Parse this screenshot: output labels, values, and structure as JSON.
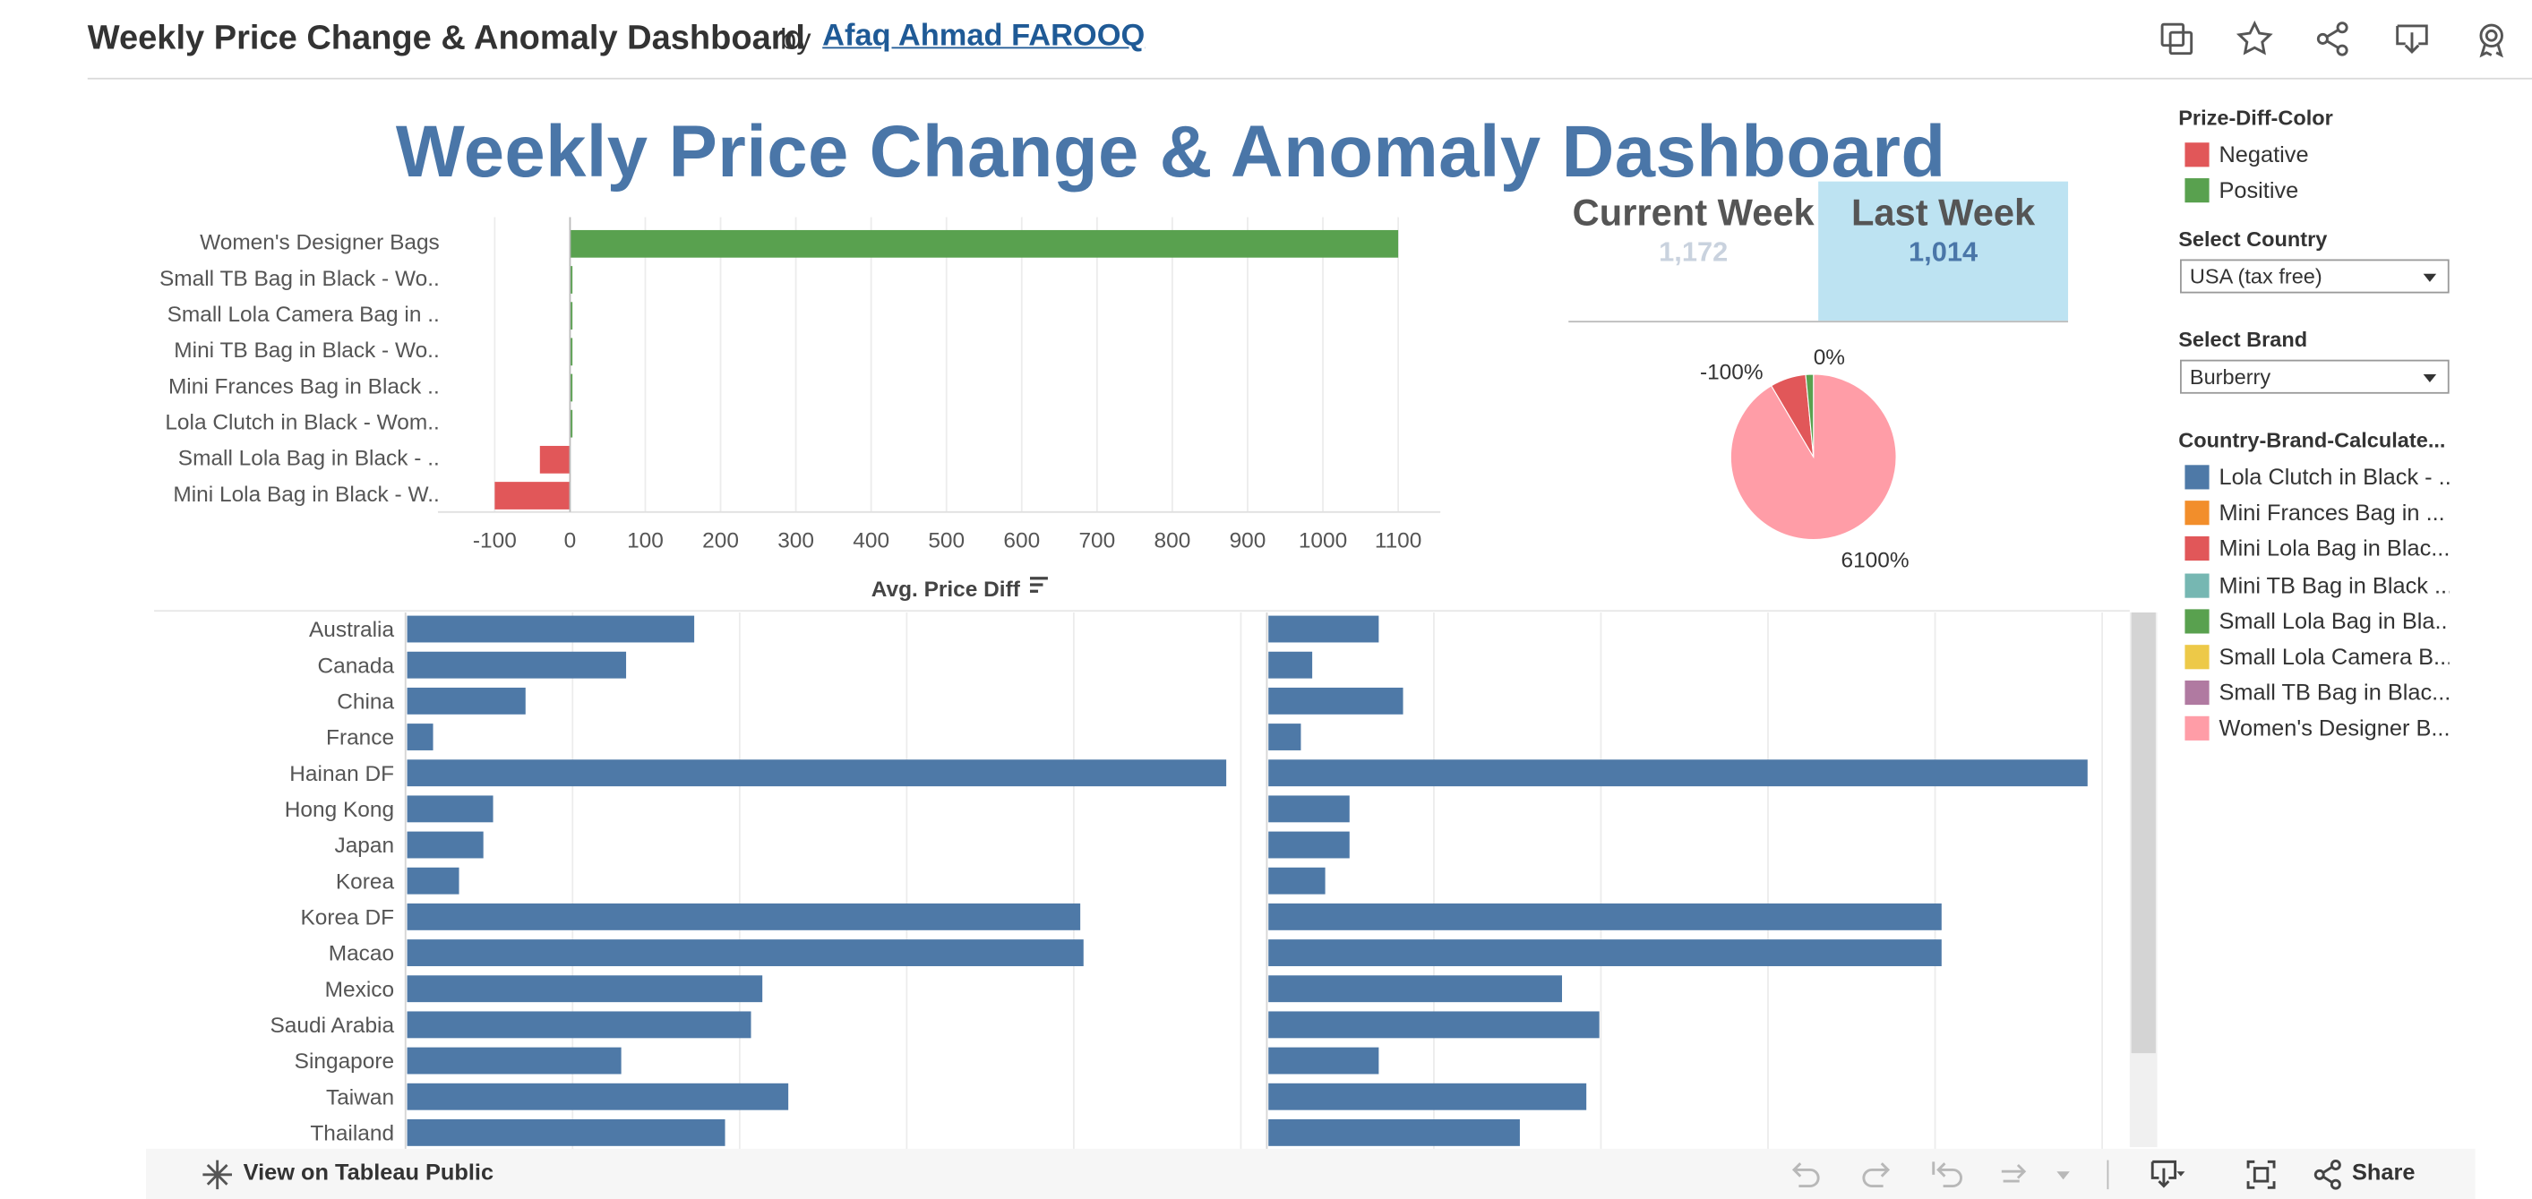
{
  "header": {
    "title": "Weekly Price Change & Anomaly Dashboard",
    "by": "by",
    "author": "Afaq Ahmad FAROOQ",
    "icons": [
      "copy-icon",
      "star-icon",
      "share-icon",
      "download-icon",
      "badge-icon"
    ]
  },
  "dashboard": {
    "title": "Weekly Price Change & Anomaly Dashboard"
  },
  "kpi": {
    "current_label": "Current Week",
    "current_value": "1,172",
    "last_label": "Last Week",
    "last_value": "1,014"
  },
  "right_panel": {
    "prize_legend_title": "Prize-Diff-Color",
    "prize_legend": [
      {
        "label": "Negative",
        "color": "#e15759"
      },
      {
        "label": "Positive",
        "color": "#59a14f"
      }
    ],
    "country_filter_title": "Select Country",
    "country_filter_value": "USA (tax free)",
    "brand_filter_title": "Select Brand",
    "brand_filter_value": "Burberry",
    "cbc_legend_title": "Country-Brand-Calculate...",
    "cbc_legend": [
      {
        "label": "Lola Clutch in Black - ...",
        "color": "#4e79a7"
      },
      {
        "label": "Mini Frances Bag in ...",
        "color": "#f28e2b"
      },
      {
        "label": "Mini Lola Bag in Blac...",
        "color": "#e15759"
      },
      {
        "label": "Mini TB Bag in Black ...",
        "color": "#76b7b2"
      },
      {
        "label": "Small Lola Bag in Bla...",
        "color": "#59a14f"
      },
      {
        "label": "Small Lola Camera B...",
        "color": "#edc948"
      },
      {
        "label": "Small TB Bag in Blac...",
        "color": "#b07aa1"
      },
      {
        "label": "Women's Designer B...",
        "color": "#ff9da7"
      }
    ]
  },
  "toolbar": {
    "view_label": "View on Tableau Public",
    "share_label": "Share"
  },
  "chart_data": [
    {
      "type": "bar",
      "orientation": "horizontal",
      "categories": [
        "Women's Designer Bags",
        "Small TB Bag in Black - Wo..",
        "Small Lola Camera Bag in ..",
        "Mini TB Bag in Black - Wo..",
        "Mini Frances Bag in Black ..",
        "Lola Clutch in Black - Wom..",
        "Small Lola Bag in Black - ..",
        "Mini Lola Bag in Black - W.."
      ],
      "values": [
        1100,
        2,
        2,
        2,
        2,
        2,
        -40,
        -100
      ],
      "colors": [
        "#59a14f",
        "#59a14f",
        "#59a14f",
        "#59a14f",
        "#59a14f",
        "#59a14f",
        "#e15759",
        "#e15759"
      ],
      "xlabel": "Avg. Price Diff",
      "xticks": [
        -100,
        0,
        100,
        200,
        300,
        400,
        500,
        600,
        700,
        800,
        900,
        1000,
        1100
      ],
      "xlim": [
        -100,
        1100
      ],
      "grid": true
    },
    {
      "type": "pie",
      "slices": [
        {
          "label": "6100%",
          "value": 91.5,
          "color": "#ff9da7"
        },
        {
          "label": "-100%",
          "value": 7.0,
          "color": "#e15759"
        },
        {
          "label": "0%",
          "value": 1.5,
          "color": "#59a14f"
        }
      ]
    },
    {
      "type": "bar",
      "orientation": "horizontal",
      "categories": [
        "Australia",
        "Canada",
        "China",
        "France",
        "Hainan DF",
        "Hong Kong",
        "Japan",
        "Korea",
        "Korea DF",
        "Macao",
        "Mexico",
        "Saudi Arabia",
        "Singapore",
        "Taiwan",
        "Thailand"
      ],
      "series": [
        {
          "values": [
            177,
            135,
            73,
            16,
            505,
            53,
            47,
            32,
            415,
            417,
            219,
            212,
            132,
            235,
            196
          ],
          "color": "#4e79a7"
        },
        {
          "values": [
            68,
            27,
            83,
            20,
            505,
            50,
            50,
            35,
            415,
            415,
            181,
            204,
            68,
            196,
            155
          ],
          "color": "#4e79a7"
        }
      ],
      "grid": true
    }
  ]
}
